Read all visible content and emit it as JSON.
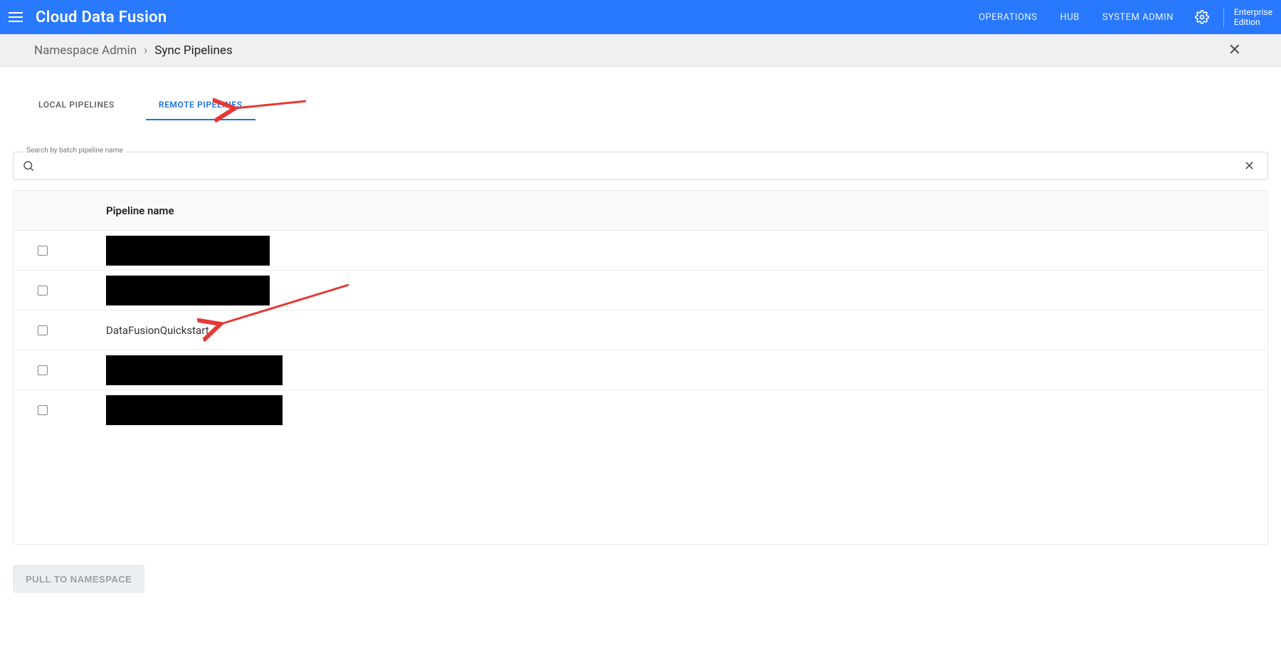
{
  "header": {
    "app_title": "Cloud Data Fusion",
    "nav": [
      "OPERATIONS",
      "HUB",
      "SYSTEM ADMIN"
    ],
    "edition_line1": "Enterprise",
    "edition_line2": "Edition"
  },
  "breadcrumb": {
    "parent": "Namespace Admin",
    "separator": "›",
    "current": "Sync Pipelines"
  },
  "tabs": [
    {
      "label": "LOCAL PIPELINES",
      "active": false
    },
    {
      "label": "REMOTE PIPELINES",
      "active": true
    }
  ],
  "search": {
    "label": "Search by batch pipeline name",
    "value": ""
  },
  "table": {
    "header": {
      "name": "Pipeline name"
    },
    "rows": [
      {
        "checked": false,
        "name_redacted": true,
        "name": "",
        "redact_width": 230
      },
      {
        "checked": false,
        "name_redacted": true,
        "name": "",
        "redact_width": 230
      },
      {
        "checked": false,
        "name_redacted": false,
        "name": "DataFusionQuickstart",
        "redact_width": 0
      },
      {
        "checked": false,
        "name_redacted": true,
        "name": "",
        "redact_width": 248
      },
      {
        "checked": false,
        "name_redacted": true,
        "name": "",
        "redact_width": 248
      }
    ]
  },
  "actions": {
    "pull_label": "PULL TO NAMESPACE",
    "pull_enabled": false
  },
  "annotations": {
    "arrow_to_tab": true,
    "arrow_to_row": true
  }
}
